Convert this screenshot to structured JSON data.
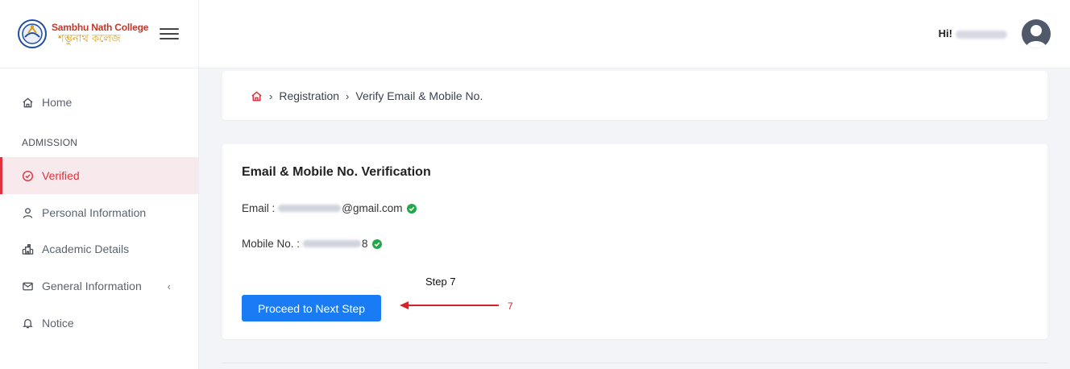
{
  "brand": {
    "name_en": "Sambhu Nath College",
    "name_bn": "শম্ভুনাথ কলেজ"
  },
  "header": {
    "greeting": "Hi!"
  },
  "sidebar": {
    "items": [
      {
        "label": "Home",
        "icon": "home-icon"
      },
      {
        "label": "Verified",
        "icon": "check-circle-icon",
        "active": true
      },
      {
        "label": "Personal Information",
        "icon": "user-icon"
      },
      {
        "label": "Academic Details",
        "icon": "school-icon"
      },
      {
        "label": "General Information",
        "icon": "mail-icon"
      },
      {
        "label": "Notice",
        "icon": "bell-icon"
      }
    ],
    "section_label": "ADMISSION",
    "submenu_chevron": "‹"
  },
  "breadcrumb": {
    "items": [
      "Registration",
      "Verify Email & Mobile No."
    ],
    "separator": "›"
  },
  "verification": {
    "title": "Email & Mobile No. Verification",
    "email_label": "Email :",
    "email_domain": "@gmail.com",
    "mobile_label": "Mobile No. :",
    "mobile_suffix": "8",
    "button_label": "Proceed to Next Step"
  },
  "annotation": {
    "step_label": "Step 7",
    "step_number": "7"
  },
  "colors": {
    "accent_red": "#e0313c",
    "primary_button": "#1a7cf5",
    "verified_green": "#22a84a"
  }
}
